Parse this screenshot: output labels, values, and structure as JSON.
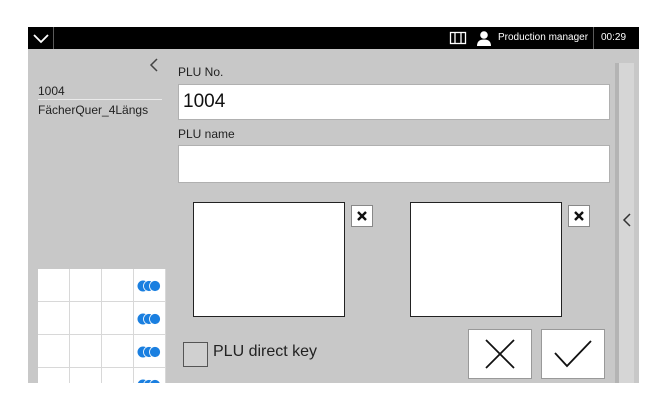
{
  "topbar": {
    "user_role": "Production manager",
    "time": "00:29"
  },
  "left_panel": {
    "plu_number": "1004",
    "plu_name": "FächerQuer_4Längs"
  },
  "form": {
    "plu_no_label": "PLU No.",
    "plu_no_value": "1004",
    "plu_name_label": "PLU name",
    "plu_name_value": "",
    "direct_key_label": "PLU direct key",
    "direct_key_checked": false
  },
  "icons": {
    "menu": "chevron-down-icon",
    "machine": "machine-icon",
    "user": "user-icon",
    "back": "chevron-left-icon",
    "expand": "chevron-left-icon",
    "clear": "close-icon",
    "cancel": "close-icon",
    "confirm": "checkmark-icon",
    "key_indicator": "overlapping-dots-icon"
  },
  "colors": {
    "key_indicator": "#1a7fe0",
    "panel_background": "#c8c8c8",
    "topbar_background": "#000000"
  }
}
